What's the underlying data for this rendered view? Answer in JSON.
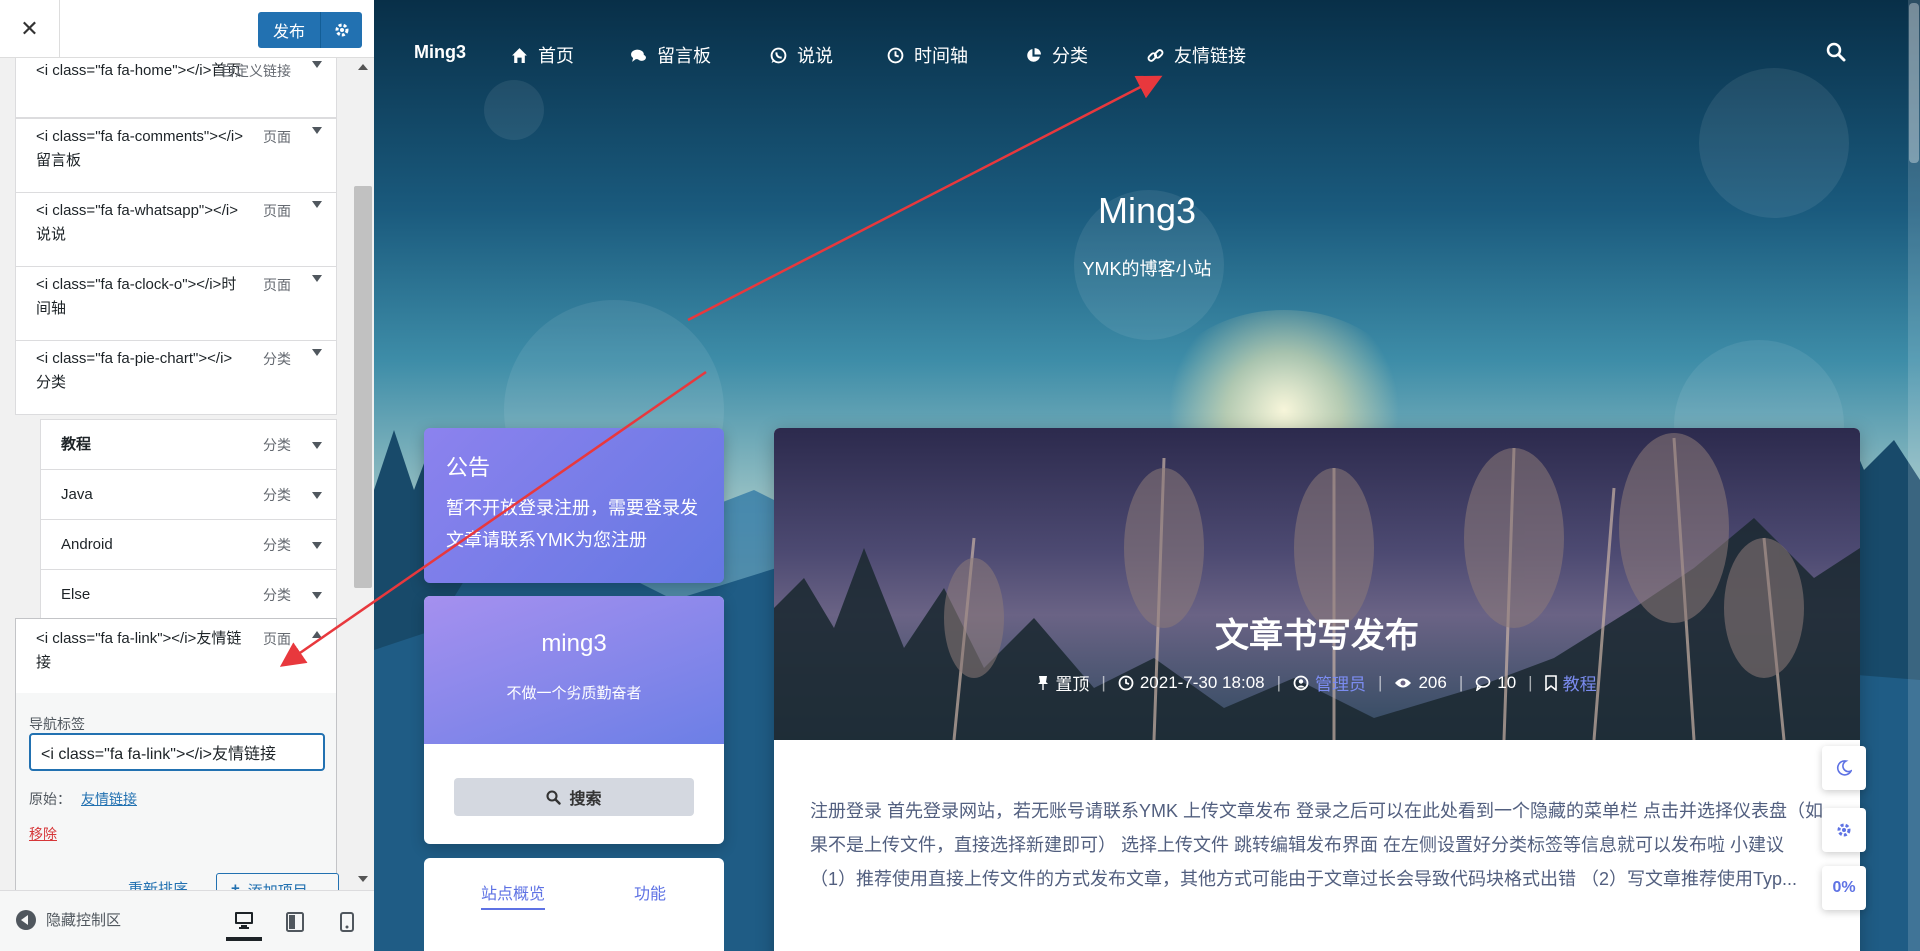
{
  "panel": {
    "close_glyph": "✕",
    "publish_label": "发布",
    "menu_items": [
      {
        "title": "<i class=\"fa fa-home\"></i>首页",
        "type": "自定义链接"
      },
      {
        "title": "<i class=\"fa fa-comments\"></i>留言板",
        "type": "页面"
      },
      {
        "title": "<i class=\"fa fa-whatsapp\"></i>说说",
        "type": "页面"
      },
      {
        "title": "<i class=\"fa fa-clock-o\"></i>时间轴",
        "type": "页面"
      },
      {
        "title": "<i class=\"fa fa-pie-chart\"></i>分类",
        "type": "分类"
      }
    ],
    "sub_items": [
      {
        "title": "教程",
        "type": "分类"
      },
      {
        "title": "Java",
        "type": "分类"
      },
      {
        "title": "Android",
        "type": "分类"
      },
      {
        "title": "Else",
        "type": "分类"
      }
    ],
    "expanded": {
      "title": "<i class=\"fa fa-link\"></i>友情链接",
      "type": "页面",
      "nav_label_caption": "导航标签",
      "nav_label_value": "<i class=\"fa fa-link\"></i>友情链接",
      "original_caption": "原始：",
      "original_link": "友情链接",
      "remove_label": "移除"
    },
    "reorder_label": "重新排序",
    "add_item_label": "添加项目",
    "collapse_label": "隐藏控制区"
  },
  "preview": {
    "brand": "Ming3",
    "nav": [
      {
        "label": "首页",
        "icon": "home-icon"
      },
      {
        "label": "留言板",
        "icon": "comments-icon"
      },
      {
        "label": "说说",
        "icon": "whatsapp-icon"
      },
      {
        "label": "时间轴",
        "icon": "clock-icon"
      },
      {
        "label": "分类",
        "icon": "pie-chart-icon"
      },
      {
        "label": "友情链接",
        "icon": "link-icon"
      }
    ],
    "site_title": "Ming3",
    "site_subtitle": "YMK的博客小站",
    "notice": {
      "title": "公告",
      "body": "暂不开放登录注册，需要登录发文章请联系YMK为您注册"
    },
    "profile": {
      "name": "ming3",
      "motto": "不做一个劣质勤奋者",
      "search_label": "搜索"
    },
    "tabs": [
      "站点概览",
      "功能"
    ],
    "post": {
      "title": "文章书写发布",
      "pinned": "置顶",
      "date": "2021-7-30 18:08",
      "author": "管理员",
      "views": "206",
      "comments": "10",
      "category": "教程",
      "excerpt": "注册登录 首先登录网站，若无账号请联系YMK 上传文章发布 登录之后可以在此处看到一个隐藏的菜单栏 点击并选择仪表盘（如果不是上传文件，直接选择新建即可） 选择上传文件 跳转编辑发布界面 在左侧设置好分类标签等信息就可以发布啦 小建议 （1）推荐使用直接上传文件的方式发布文章，其他方式可能由于文章过长会导致代码块格式出错 （2）写文章推荐使用Typ..."
    },
    "float": {
      "progress": "0%"
    }
  },
  "colors": {
    "wp_blue": "#2271b1",
    "accent": "#5e72e4",
    "annotation_red": "#e8383d"
  }
}
